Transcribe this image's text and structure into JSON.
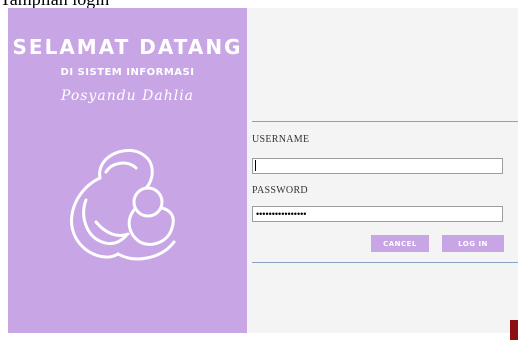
{
  "caption": "Tampilan login",
  "welcome": {
    "title": "SELAMAT DATANG",
    "subtitle": "DI SISTEM INFORMASI",
    "brand": "Posyandu Dahlia"
  },
  "login": {
    "username_label": "USERNAME",
    "username_value": "",
    "password_label": "PASSWORD",
    "password_value": "••••••••••••••••",
    "cancel_label": "CANCEL",
    "login_label": "LOG IN"
  },
  "colors": {
    "accent": "#c8a6e6",
    "panel_bg": "#f4f4f4",
    "separator": "#8aa2bf",
    "corner_mark": "#8b0e13"
  },
  "icons": {
    "logo": "mother-child-icon"
  }
}
